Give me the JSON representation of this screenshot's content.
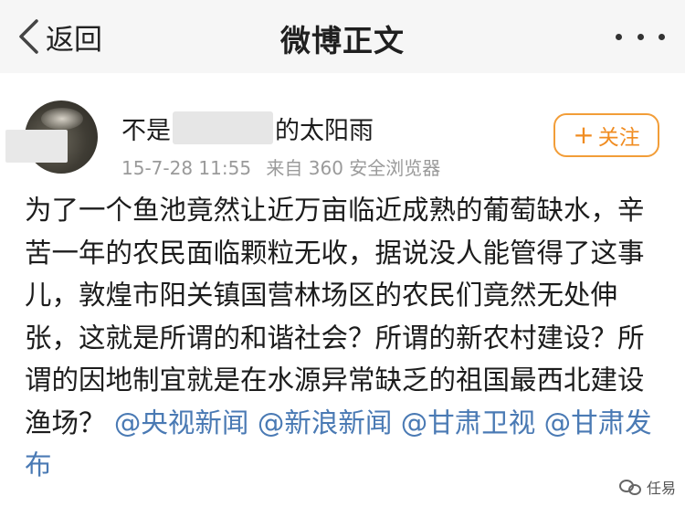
{
  "navbar": {
    "back_label": "返回",
    "title": "微博正文"
  },
  "post": {
    "author_prefix": "不是",
    "author_suffix": "的太阳雨",
    "timestamp": "15-7-28 11:55",
    "source": "来自 360 安全浏览器",
    "follow_label": "关注",
    "follow_prefix": "+",
    "body": "为了一个鱼池竟然让近万亩临近成熟的葡萄缺水，辛苦一年的农民面临颗粒无收，据说没人能管得了这事儿，敦煌市阳关镇国营林场区的农民们竟然无处伸张，这就是所谓的和谐社会？所谓的新农村建设？所谓的因地制宜就是在水源异常缺乏的祖国最西北建设渔场？",
    "mentions": [
      "@央视新闻",
      "@新浪新闻",
      "@甘肃卫视",
      "@甘肃发布"
    ]
  },
  "watermark": {
    "text": "任易"
  },
  "colors": {
    "accent_orange": "#f08c21",
    "mention_blue": "#4a7ab4",
    "meta_gray": "#9a9a9a",
    "navbar_bg": "#f6f6f6"
  }
}
